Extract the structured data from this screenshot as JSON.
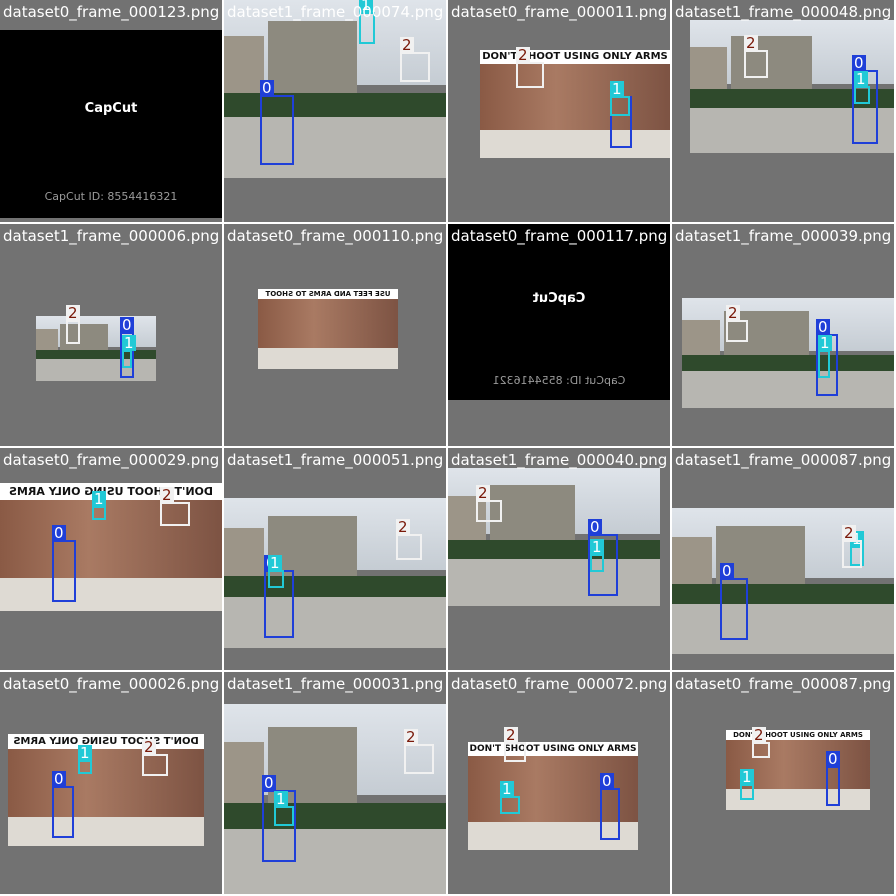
{
  "colors": {
    "class_0": "#1f3fd8",
    "class_1": "#21c9d6",
    "class_2": "#f1f1f1",
    "pad": "#727272"
  },
  "tiles": [
    {
      "title": "dataset0_frame_000123.png",
      "kind": "capcut",
      "logo": "CapCut",
      "id_text": "CapCut ID: 8554416321",
      "flip": false,
      "labels": []
    },
    {
      "title": "dataset1_frame_000074.png",
      "kind": "court",
      "flip": false,
      "labels": [
        "0",
        "1",
        "2"
      ]
    },
    {
      "title": "dataset0_frame_000011.png",
      "kind": "wall",
      "banner": "DON'T SHOOT USING ONLY ARMS",
      "flip": false,
      "labels": [
        "0",
        "1",
        "2"
      ]
    },
    {
      "title": "dataset1_frame_000048.png",
      "kind": "court",
      "flip": false,
      "labels": [
        "0",
        "1",
        "2"
      ]
    },
    {
      "title": "dataset1_frame_000006.png",
      "kind": "court",
      "flip": false,
      "labels": [
        "0",
        "1",
        "2"
      ]
    },
    {
      "title": "dataset0_frame_000110.png",
      "kind": "wall",
      "banner": "USE FEET AND ARMS TO SHOOT",
      "flip": true,
      "labels": [
        "0",
        "1",
        "2"
      ]
    },
    {
      "title": "dataset0_frame_000117.png",
      "kind": "capcut",
      "logo": "CapCut",
      "id_text": "CapCut ID: 8554416321",
      "flip": true,
      "labels": []
    },
    {
      "title": "dataset1_frame_000039.png",
      "kind": "court",
      "flip": false,
      "labels": [
        "0",
        "1",
        "2"
      ]
    },
    {
      "title": "dataset0_frame_000029.png",
      "kind": "wall",
      "banner": "DON'T SHOOT USING ONLY ARMS",
      "flip": true,
      "labels": [
        "0",
        "1",
        "2"
      ]
    },
    {
      "title": "dataset1_frame_000051.png",
      "kind": "court",
      "flip": false,
      "labels": [
        "0",
        "1",
        "2"
      ]
    },
    {
      "title": "dataset1_frame_000040.png",
      "kind": "court",
      "flip": false,
      "labels": [
        "0",
        "1",
        "2"
      ]
    },
    {
      "title": "dataset1_frame_000087.png",
      "kind": "court",
      "flip": false,
      "labels": [
        "0",
        "1",
        "2"
      ]
    },
    {
      "title": "dataset0_frame_000026.png",
      "kind": "wall",
      "banner": "DON'T SHOOT USING ONLY ARMS",
      "flip": true,
      "labels": [
        "0",
        "1",
        "2"
      ]
    },
    {
      "title": "dataset1_frame_000031.png",
      "kind": "court",
      "flip": false,
      "labels": [
        "0",
        "1",
        "2"
      ]
    },
    {
      "title": "dataset0_frame_000072.png",
      "kind": "wall",
      "banner": "DON'T SHOOT USING ONLY ARMS",
      "flip": false,
      "labels": [
        "0",
        "1",
        "2"
      ]
    },
    {
      "title": "dataset0_frame_000087.png",
      "kind": "wall",
      "banner": "DON'T SHOOT USING ONLY ARMS",
      "flip": false,
      "labels": [
        "0",
        "1",
        "2"
      ]
    }
  ]
}
